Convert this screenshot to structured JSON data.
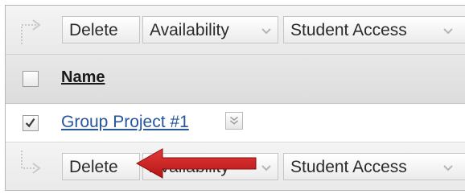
{
  "top_toolbar": {
    "delete_label": "Delete",
    "availability_label": "Availability",
    "student_access_label": "Student Access"
  },
  "table": {
    "header": {
      "name_label": "Name"
    },
    "rows": [
      {
        "name": "Group Project #1",
        "checked": true
      }
    ]
  },
  "bottom_toolbar": {
    "delete_label": "Delete",
    "availability_label": "Availability",
    "student_access_label": "Student Access"
  },
  "annotation": {
    "arrow_color": "#d01f1f"
  },
  "colors": {
    "link": "#27569a",
    "toolbar_bg": "#efefef",
    "header_bg": "#e2e2e2"
  }
}
